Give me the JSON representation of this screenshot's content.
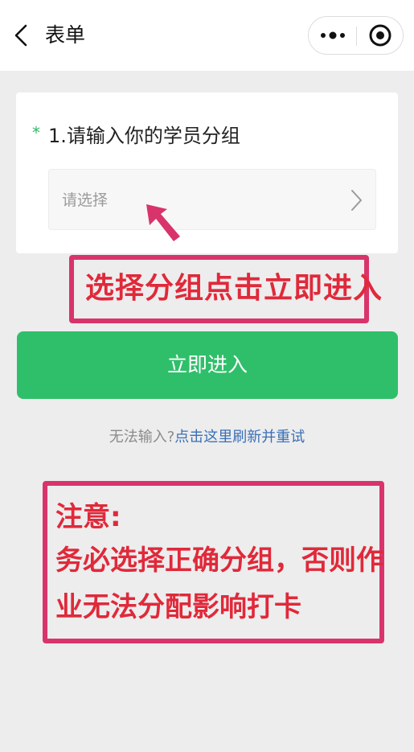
{
  "header": {
    "back_icon": "chevron-left-icon",
    "title": "表单",
    "more_icon": "more-dots-icon",
    "close_icon": "target-circle-icon"
  },
  "form": {
    "required_mark": "*",
    "label": "1.请输入你的学员分组",
    "select_placeholder": "请选择",
    "select_icon": "chevron-right-icon"
  },
  "annotations": {
    "note1": "选择分组点击立即进入",
    "note2_line1": "注意:",
    "note2_line2": "务必选择正确分组，否则作",
    "note2_line3": "业无法分配影响打卡",
    "accent_color": "#d8346b",
    "text_color": "#e0293a"
  },
  "submit": {
    "label": "立即进入",
    "color": "#2fbf6a"
  },
  "retry": {
    "prefix": "无法输入?",
    "link": "点击这里刷新并重试"
  }
}
